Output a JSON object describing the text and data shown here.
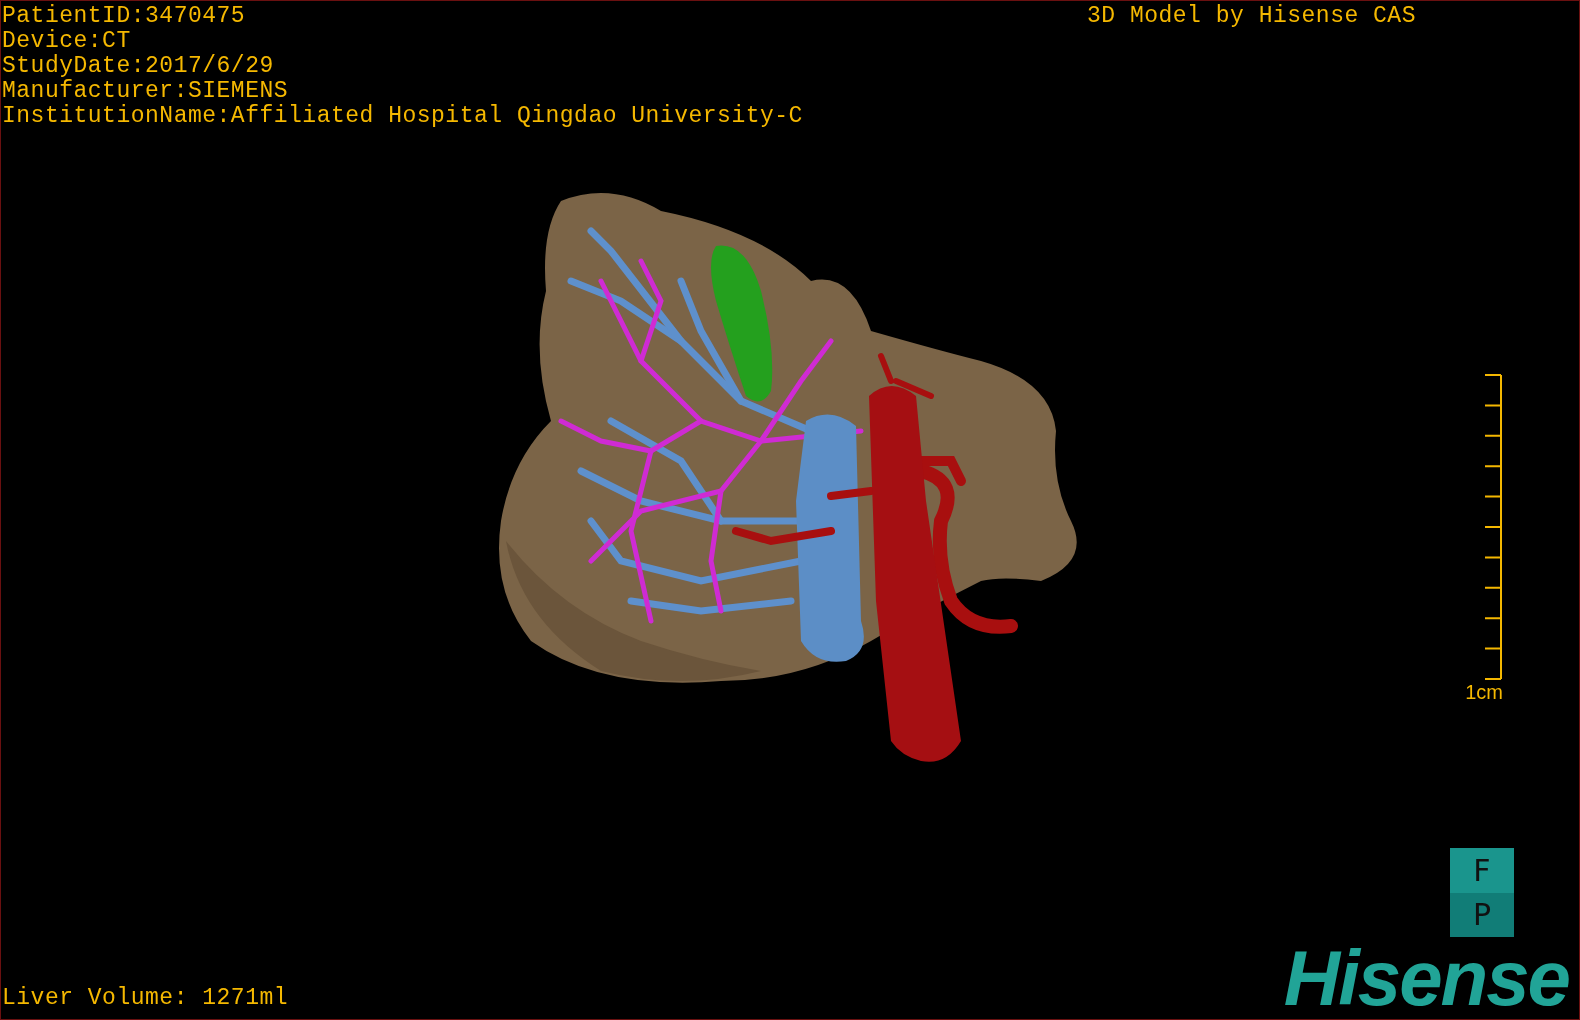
{
  "info_lines": [
    "PatientID:3470475",
    "Device:CT",
    "StudyDate:2017/6/29",
    "Manufacturer:SIEMENS",
    "InstitutionName:Affiliated Hospital Qingdao University-C"
  ],
  "title": "3D Model by Hisense CAS",
  "scale": {
    "label": "1cm"
  },
  "orientation": {
    "top": "F",
    "bottom": "P"
  },
  "liver_volume": "Liver Volume: 1271ml",
  "logo": "Hisense"
}
